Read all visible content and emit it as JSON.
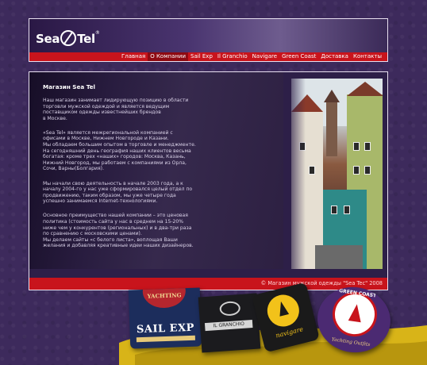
{
  "header": {
    "logo_text_left": "Sea",
    "logo_text_right": "Tel",
    "logo_mark": "®",
    "nav": [
      {
        "label": "Главная",
        "active": false
      },
      {
        "label": "О Компании",
        "active": true
      },
      {
        "label": "Sail Exp",
        "active": false
      },
      {
        "label": "Il Granchio",
        "active": false
      },
      {
        "label": "Navigare",
        "active": false
      },
      {
        "label": "Green Coast",
        "active": false
      },
      {
        "label": "Доставка",
        "active": false
      },
      {
        "label": "Контакты",
        "active": false
      }
    ]
  },
  "article": {
    "title": "Магазин Sea Tel",
    "paragraphs": [
      "Наш магазин занимает лидирующую позицию в области\nторговли мужской одеждой и является ведущим\nпоставщиком одежды известнейших брендов\nв Москве.",
      "«Sea Tel» является межрегиональной компанией с\nофисами в Москве, Нижнем Новгороде и Казани.\nМы обладаем большим опытом в торговле и менеджменте.\nНа сегодняшний день  география наших клиентов  весьма\nбогатая: кроме трех «наших» городов: Москва, Казань,\nНижний Новгород, мы работаем с компаниями из Орла,\nСочи, Варны(Болгария).",
      "Мы начали свою деятельность в начале 2003 года, а к\nначалу 2004-го у нас уже сформировался целый отдел по\nпродвижению, таким образом, мы уже четыре года\nуспешно занимаемся Internet-технологиями.",
      "Основное преимущество нашей компании – это ценовая\nполитика (стоимость сайта у нас в среднем на 15-20%\nниже чем у конкурентов (региональных) и в два-три раза\nпо сравнению с московскими ценами).\nМы делаем сайты «с белого листа», воплощая Ваши\nжелания и добавляя креативные идеи наших дизайнеров."
    ]
  },
  "footer": {
    "copyright": "© Магазин мужской одежды \"Sea Tec\" 2008"
  },
  "labels": {
    "sail_top": "YACHTING",
    "sail_main": "SAIL EXP",
    "granchio": "IL GRANCHIO",
    "navigare": "navigare",
    "green_top": "GREEN COAST",
    "green_bottom": "Yachting Outfits"
  },
  "colors": {
    "accent": "#c8141c",
    "background": "#3d2a5c",
    "header": "#2a1845"
  }
}
